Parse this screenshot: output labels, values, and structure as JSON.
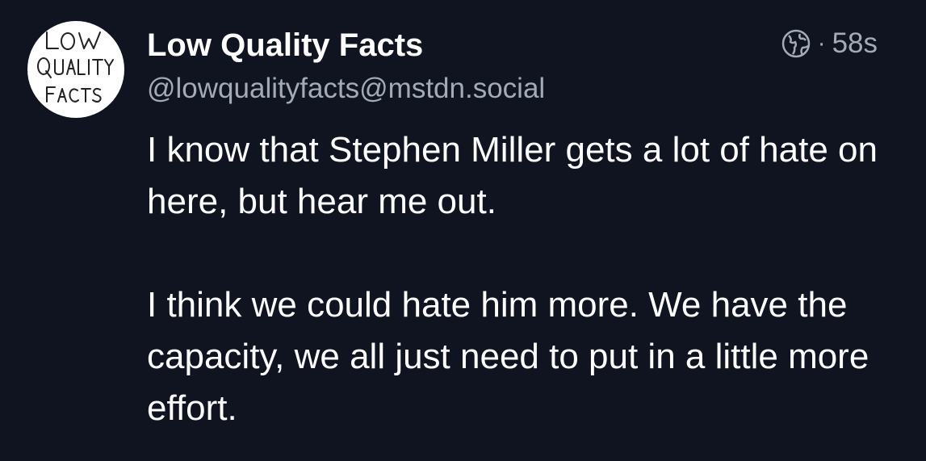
{
  "post": {
    "avatar": {
      "text_lines": [
        "LOW",
        "QUALITY",
        "FACTS"
      ]
    },
    "author": {
      "display_name": "Low Quality Facts",
      "handle": "@lowqualityfacts@mstdn.social"
    },
    "meta": {
      "visibility_icon": "globe-icon",
      "separator": "·",
      "time_ago": "58s"
    },
    "content": {
      "paragraph_1": "I know that Stephen Miller gets a lot of hate on here, but hear me out.",
      "paragraph_2": "I think we could hate him more. We have the capacity, we all just need to put in a little more effort."
    }
  },
  "colors": {
    "background": "#0f1420",
    "primary_text": "#ffffff",
    "secondary_text": "#a3aab8"
  }
}
